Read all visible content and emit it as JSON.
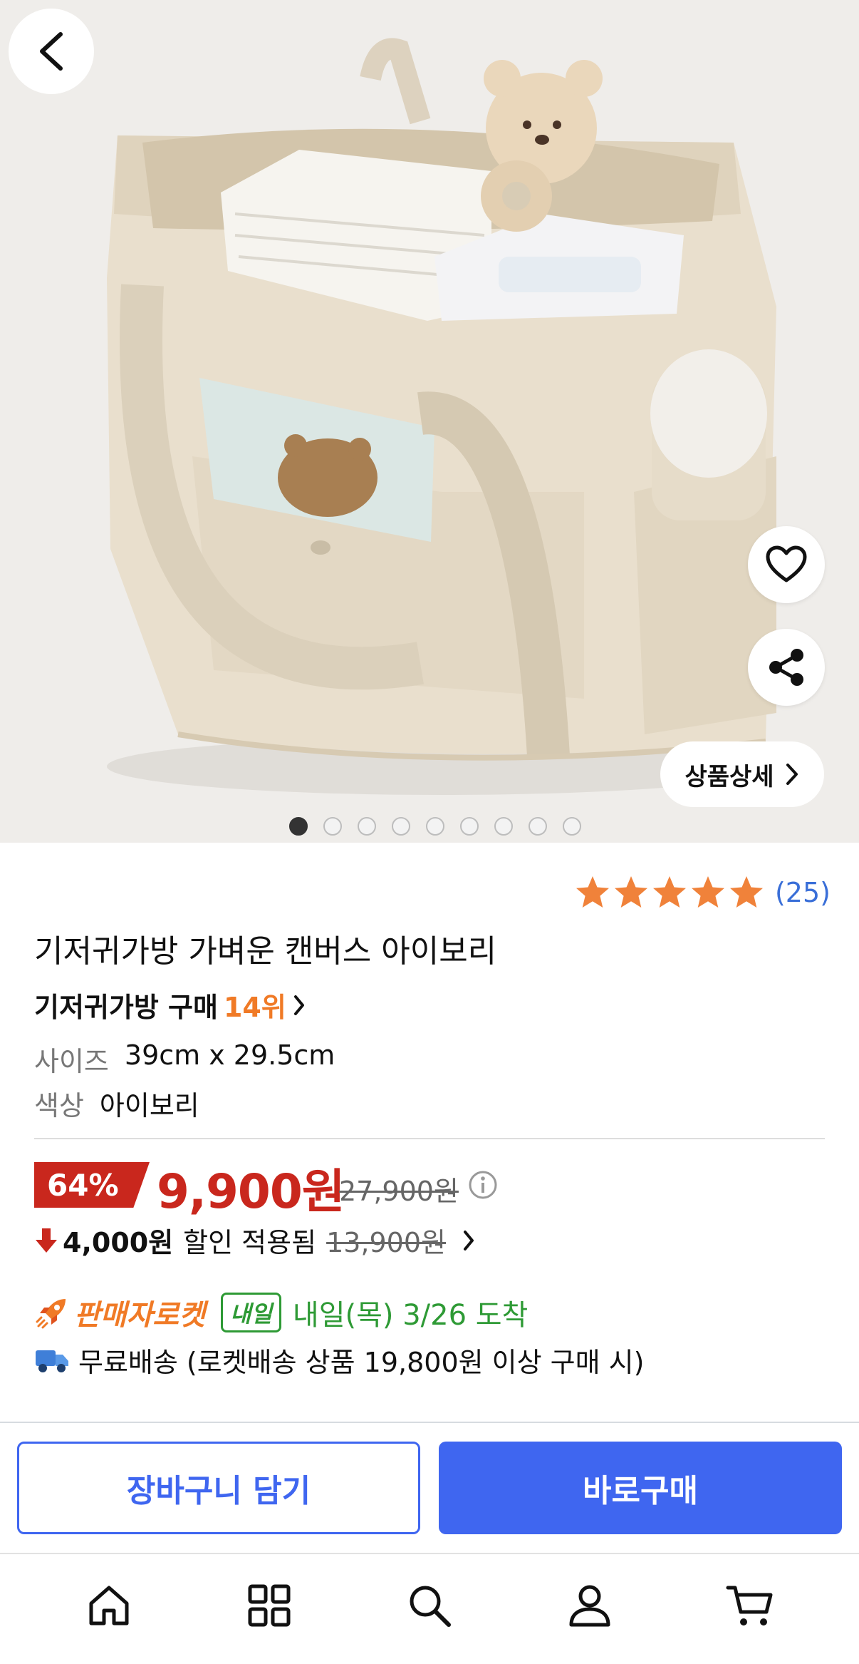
{
  "gallery": {
    "image_count": 9,
    "active_index": 0,
    "detail_label": "상품상세"
  },
  "rating": {
    "stars": 5,
    "count": "(25)"
  },
  "product": {
    "title": "기저귀가방 가벼운 캔버스 아이보리",
    "rank_label": "기저귀가방 구매",
    "rank_value": "14위",
    "attributes": [
      {
        "key": "사이즈",
        "value": "39cm x 29.5cm"
      },
      {
        "key": "색상",
        "value": "아이보리"
      }
    ]
  },
  "price": {
    "discount": "64%",
    "sale": "9,900원",
    "original": "27,900원",
    "coupon_amount": "4,000원",
    "coupon_text": "할인 적용됨",
    "coupon_before": "13,900원"
  },
  "delivery": {
    "seller_rocket": "판매자로켓",
    "tomorrow_badge": "내일",
    "arrival": "내일(목) 3/26 도착",
    "free_shipping": "무료배송 (로켓배송 상품 19,800원 이상 구매 시)"
  },
  "actions": {
    "cart": "장바구니 담기",
    "buy": "바로구매"
  },
  "colors": {
    "accent_blue": "#3f66f0",
    "price_red": "#c9271d",
    "star_orange": "#f0823a",
    "delivery_green": "#2e9a35"
  },
  "nav": [
    "home-icon",
    "category-icon",
    "search-icon",
    "account-icon",
    "cart-icon"
  ]
}
